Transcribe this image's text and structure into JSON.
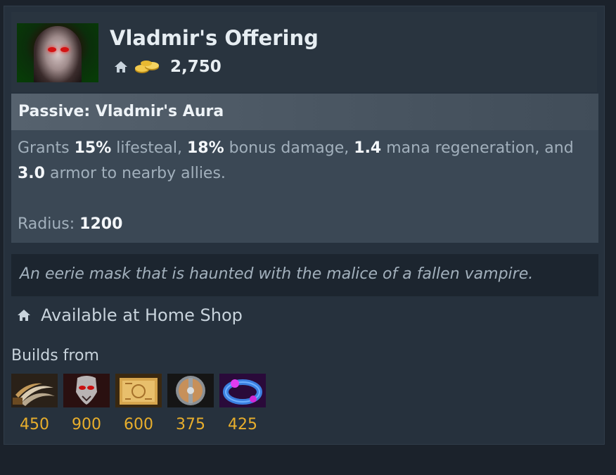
{
  "item": {
    "name": "Vladmir's Offering",
    "icon": "vladmirs-offering-icon",
    "cost": "2,750"
  },
  "ability": {
    "title": "Passive: Vladmir's Aura",
    "desc": {
      "p1": "Grants ",
      "lifesteal": "15%",
      "p2": " lifesteal, ",
      "damage": "18%",
      "p3": " bonus damage, ",
      "mana": "1.4",
      "p4": " mana regeneration, and ",
      "armor": "3.0",
      "p5": " armor to nearby allies."
    },
    "radius_label": "Radius: ",
    "radius_value": "1200"
  },
  "lore": "An eerie mask that is haunted with the malice of a fallen vampire.",
  "availability": "Available at Home Shop",
  "builds_from_label": "Builds from",
  "components": [
    {
      "icon": "blades-of-attack-icon",
      "cost": "450"
    },
    {
      "icon": "morbid-mask-icon",
      "cost": "900"
    },
    {
      "icon": "recipe-scroll-icon",
      "cost": "600"
    },
    {
      "icon": "buckler-icon",
      "cost": "375"
    },
    {
      "icon": "ring-of-basilius-icon",
      "cost": "425"
    }
  ],
  "colors": {
    "background": "#1b222b",
    "panel": "#26313d",
    "gold": "#e8ae2c",
    "muted_text": "#a2b0bc",
    "highlight_text": "#f4f7fa"
  }
}
